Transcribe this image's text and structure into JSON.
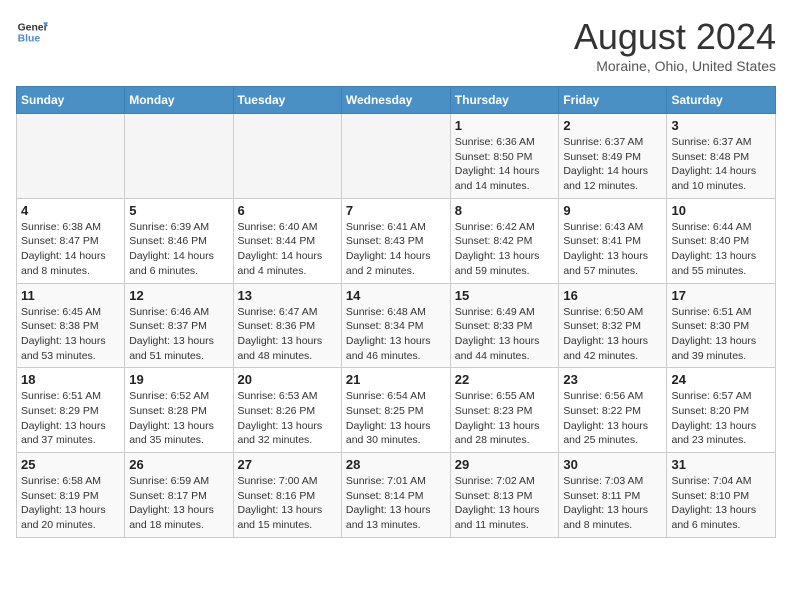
{
  "header": {
    "logo_line1": "General",
    "logo_line2": "Blue",
    "month_title": "August 2024",
    "location": "Moraine, Ohio, United States"
  },
  "weekdays": [
    "Sunday",
    "Monday",
    "Tuesday",
    "Wednesday",
    "Thursday",
    "Friday",
    "Saturday"
  ],
  "weeks": [
    [
      {
        "day": "",
        "info": ""
      },
      {
        "day": "",
        "info": ""
      },
      {
        "day": "",
        "info": ""
      },
      {
        "day": "",
        "info": ""
      },
      {
        "day": "1",
        "info": "Sunrise: 6:36 AM\nSunset: 8:50 PM\nDaylight: 14 hours\nand 14 minutes."
      },
      {
        "day": "2",
        "info": "Sunrise: 6:37 AM\nSunset: 8:49 PM\nDaylight: 14 hours\nand 12 minutes."
      },
      {
        "day": "3",
        "info": "Sunrise: 6:37 AM\nSunset: 8:48 PM\nDaylight: 14 hours\nand 10 minutes."
      }
    ],
    [
      {
        "day": "4",
        "info": "Sunrise: 6:38 AM\nSunset: 8:47 PM\nDaylight: 14 hours\nand 8 minutes."
      },
      {
        "day": "5",
        "info": "Sunrise: 6:39 AM\nSunset: 8:46 PM\nDaylight: 14 hours\nand 6 minutes."
      },
      {
        "day": "6",
        "info": "Sunrise: 6:40 AM\nSunset: 8:44 PM\nDaylight: 14 hours\nand 4 minutes."
      },
      {
        "day": "7",
        "info": "Sunrise: 6:41 AM\nSunset: 8:43 PM\nDaylight: 14 hours\nand 2 minutes."
      },
      {
        "day": "8",
        "info": "Sunrise: 6:42 AM\nSunset: 8:42 PM\nDaylight: 13 hours\nand 59 minutes."
      },
      {
        "day": "9",
        "info": "Sunrise: 6:43 AM\nSunset: 8:41 PM\nDaylight: 13 hours\nand 57 minutes."
      },
      {
        "day": "10",
        "info": "Sunrise: 6:44 AM\nSunset: 8:40 PM\nDaylight: 13 hours\nand 55 minutes."
      }
    ],
    [
      {
        "day": "11",
        "info": "Sunrise: 6:45 AM\nSunset: 8:38 PM\nDaylight: 13 hours\nand 53 minutes."
      },
      {
        "day": "12",
        "info": "Sunrise: 6:46 AM\nSunset: 8:37 PM\nDaylight: 13 hours\nand 51 minutes."
      },
      {
        "day": "13",
        "info": "Sunrise: 6:47 AM\nSunset: 8:36 PM\nDaylight: 13 hours\nand 48 minutes."
      },
      {
        "day": "14",
        "info": "Sunrise: 6:48 AM\nSunset: 8:34 PM\nDaylight: 13 hours\nand 46 minutes."
      },
      {
        "day": "15",
        "info": "Sunrise: 6:49 AM\nSunset: 8:33 PM\nDaylight: 13 hours\nand 44 minutes."
      },
      {
        "day": "16",
        "info": "Sunrise: 6:50 AM\nSunset: 8:32 PM\nDaylight: 13 hours\nand 42 minutes."
      },
      {
        "day": "17",
        "info": "Sunrise: 6:51 AM\nSunset: 8:30 PM\nDaylight: 13 hours\nand 39 minutes."
      }
    ],
    [
      {
        "day": "18",
        "info": "Sunrise: 6:51 AM\nSunset: 8:29 PM\nDaylight: 13 hours\nand 37 minutes."
      },
      {
        "day": "19",
        "info": "Sunrise: 6:52 AM\nSunset: 8:28 PM\nDaylight: 13 hours\nand 35 minutes."
      },
      {
        "day": "20",
        "info": "Sunrise: 6:53 AM\nSunset: 8:26 PM\nDaylight: 13 hours\nand 32 minutes."
      },
      {
        "day": "21",
        "info": "Sunrise: 6:54 AM\nSunset: 8:25 PM\nDaylight: 13 hours\nand 30 minutes."
      },
      {
        "day": "22",
        "info": "Sunrise: 6:55 AM\nSunset: 8:23 PM\nDaylight: 13 hours\nand 28 minutes."
      },
      {
        "day": "23",
        "info": "Sunrise: 6:56 AM\nSunset: 8:22 PM\nDaylight: 13 hours\nand 25 minutes."
      },
      {
        "day": "24",
        "info": "Sunrise: 6:57 AM\nSunset: 8:20 PM\nDaylight: 13 hours\nand 23 minutes."
      }
    ],
    [
      {
        "day": "25",
        "info": "Sunrise: 6:58 AM\nSunset: 8:19 PM\nDaylight: 13 hours\nand 20 minutes."
      },
      {
        "day": "26",
        "info": "Sunrise: 6:59 AM\nSunset: 8:17 PM\nDaylight: 13 hours\nand 18 minutes."
      },
      {
        "day": "27",
        "info": "Sunrise: 7:00 AM\nSunset: 8:16 PM\nDaylight: 13 hours\nand 15 minutes."
      },
      {
        "day": "28",
        "info": "Sunrise: 7:01 AM\nSunset: 8:14 PM\nDaylight: 13 hours\nand 13 minutes."
      },
      {
        "day": "29",
        "info": "Sunrise: 7:02 AM\nSunset: 8:13 PM\nDaylight: 13 hours\nand 11 minutes."
      },
      {
        "day": "30",
        "info": "Sunrise: 7:03 AM\nSunset: 8:11 PM\nDaylight: 13 hours\nand 8 minutes."
      },
      {
        "day": "31",
        "info": "Sunrise: 7:04 AM\nSunset: 8:10 PM\nDaylight: 13 hours\nand 6 minutes."
      }
    ]
  ]
}
